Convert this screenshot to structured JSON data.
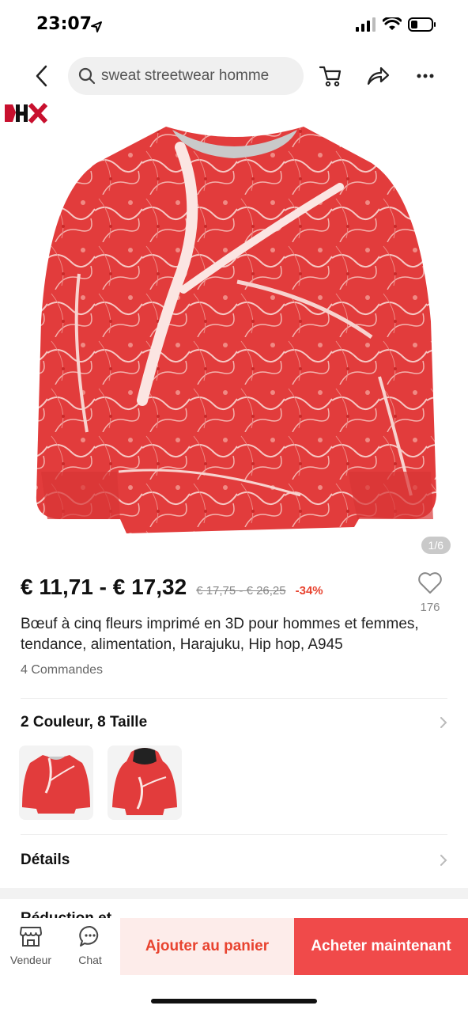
{
  "status": {
    "time": "23:07"
  },
  "search": {
    "query": "sweat streetwear homme"
  },
  "brand": {
    "logo_text": "HX"
  },
  "gallery": {
    "counter": "1/6"
  },
  "price": {
    "range": "€ 11,71 - € 17,32",
    "original": "€ 17,75 - € 26,25",
    "discount": "-34%"
  },
  "wishlist": {
    "count": "176"
  },
  "product": {
    "title": "Bœuf à cinq fleurs imprimé en 3D pour hommes et femmes, tendance, alimentation, Harajuku, Hip hop, A945",
    "orders": "4 Commandes"
  },
  "variants": {
    "label": "2 Couleur, 8 Taille"
  },
  "details": {
    "label": "Détails"
  },
  "partial": {
    "text": "Réduction et"
  },
  "bottom": {
    "seller": "Vendeur",
    "chat": "Chat",
    "add_to_cart": "Ajouter au panier",
    "buy_now": "Acheter maintenant"
  },
  "colors": {
    "accent": "#f04a4a",
    "accent_light": "#fdecea",
    "discount": "#e8432f",
    "meat": "#e23c3c"
  }
}
